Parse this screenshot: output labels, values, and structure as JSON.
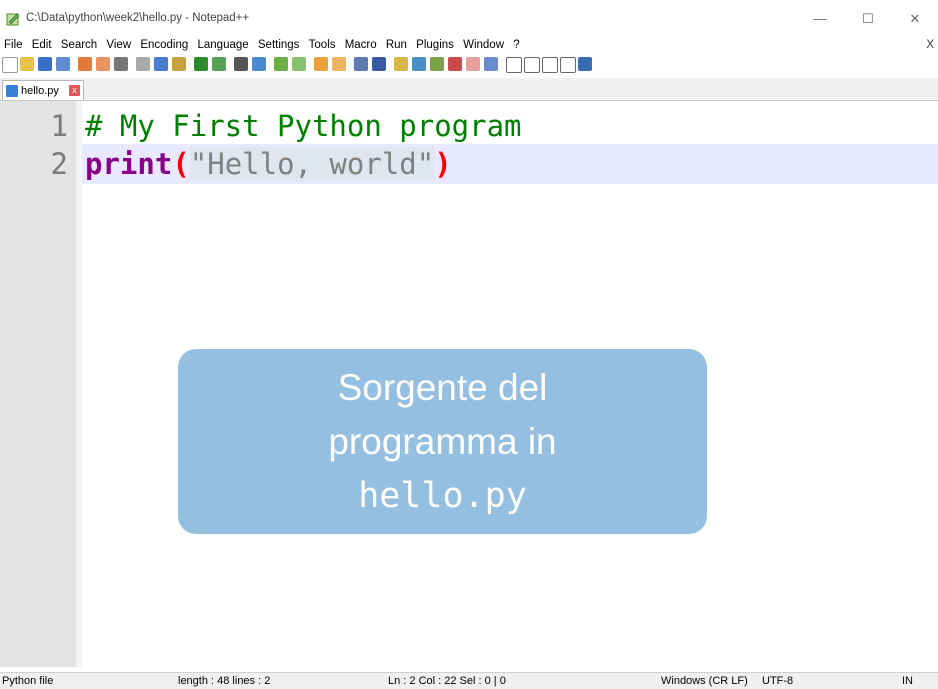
{
  "window": {
    "title": "C:\\Data\\python\\week2\\hello.py - Notepad++",
    "minimize": "—",
    "maximize": "☐",
    "close": "✕"
  },
  "menu": {
    "items": [
      "File",
      "Edit",
      "Search",
      "View",
      "Encoding",
      "Language",
      "Settings",
      "Tools",
      "Macro",
      "Run",
      "Plugins",
      "Window",
      "?"
    ],
    "close_doc": "X"
  },
  "tab": {
    "label": "hello.py",
    "close": "x"
  },
  "editor": {
    "lines": [
      {
        "number": "1",
        "comment": "# My First Python program"
      },
      {
        "number": "2",
        "keyword": "print",
        "open_paren": "(",
        "string": "\"Hello, world\"",
        "close_paren": ")"
      }
    ]
  },
  "callout": {
    "line1": "Sorgente del",
    "line2": "programma in",
    "line3": "hello.py"
  },
  "status": {
    "file_type": "Python file",
    "length_lines": "length : 48    lines : 2",
    "position": "Ln : 2    Col : 22    Sel : 0 | 0",
    "eol": "Windows (CR LF)",
    "encoding": "UTF-8",
    "mode": "IN"
  },
  "colors": {
    "comment": "#008000",
    "keyword": "#880088",
    "paren": "#ff0000",
    "string": "#808080",
    "current_line": "#e8e8ff",
    "callout_bg": "#95bfe0"
  }
}
